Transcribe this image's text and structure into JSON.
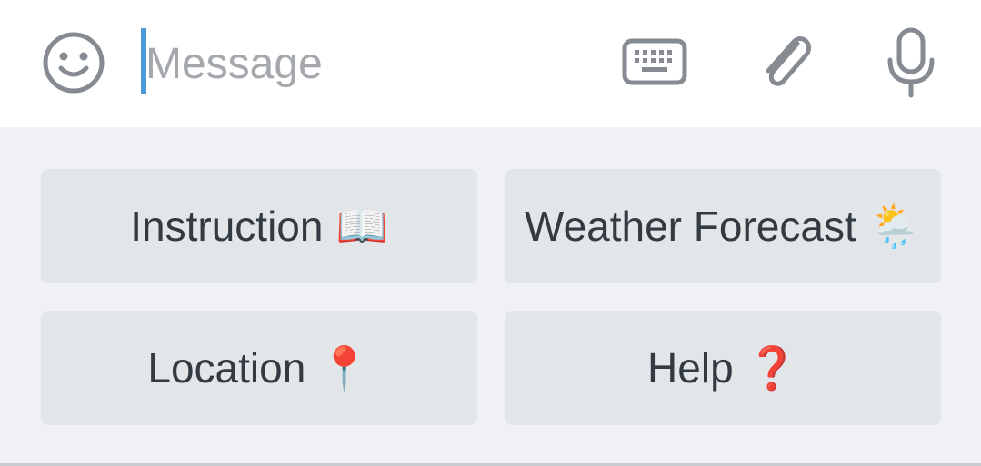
{
  "input_bar": {
    "placeholder": "Message",
    "value": "",
    "emoji_icon": "smiley-icon",
    "keyboard_icon": "keyboard-icon",
    "attach_icon": "paperclip-icon",
    "mic_icon": "microphone-icon"
  },
  "reply_keyboard": {
    "buttons": [
      {
        "label": "Instruction",
        "emoji": "📖"
      },
      {
        "label": "Weather Forecast",
        "emoji": "🌦️"
      },
      {
        "label": "Location",
        "emoji": "📍"
      },
      {
        "label": "Help",
        "emoji": "❓"
      }
    ]
  },
  "colors": {
    "cursor": "#4b9bd8",
    "icon_gray": "#858b91",
    "button_bg": "#e3e6e9",
    "panel_bg": "#eff1f4"
  }
}
